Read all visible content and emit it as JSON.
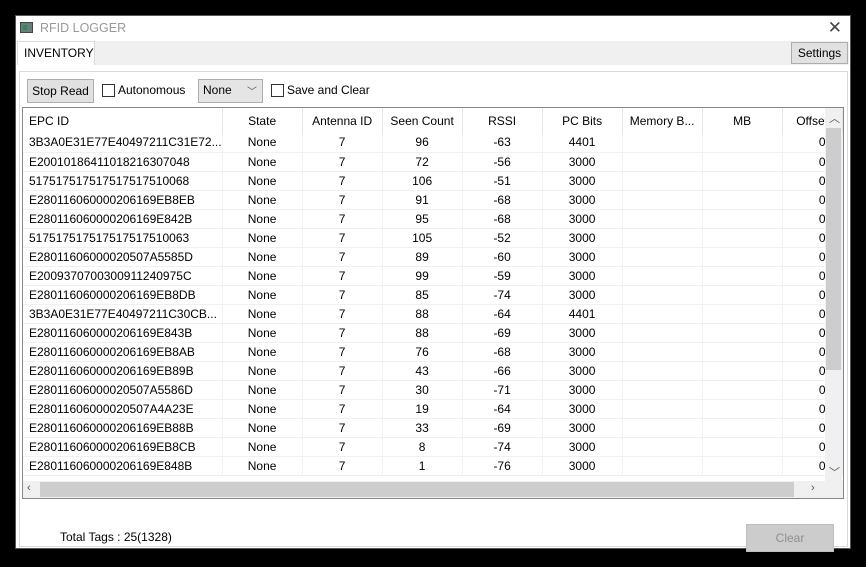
{
  "window": {
    "title": "RFID LOGGER"
  },
  "tabs": [
    {
      "label": "INVENTORY",
      "active": true
    }
  ],
  "settings_label": "Settings",
  "toolbar": {
    "stop_read_label": "Stop Read",
    "autonomous_label": "Autonomous",
    "autonomous_checked": false,
    "mode_value": "None",
    "save_clear_label": "Save and Clear",
    "save_clear_checked": false
  },
  "table": {
    "columns": [
      "EPC ID",
      "State",
      "Antenna ID",
      "Seen Count",
      "RSSI",
      "PC Bits",
      "Memory B...",
      "MB",
      "Offset"
    ],
    "rows": [
      [
        "3B3A0E31E77E40497211C31E72...",
        "None",
        "7",
        "96",
        "-63",
        "4401",
        "",
        "",
        "0"
      ],
      [
        "E20010186411018216307048",
        "None",
        "7",
        "72",
        "-56",
        "3000",
        "",
        "",
        "0"
      ],
      [
        "517517517517517517510068",
        "None",
        "7",
        "106",
        "-51",
        "3000",
        "",
        "",
        "0"
      ],
      [
        "E280116060000206169EB8EB",
        "None",
        "7",
        "91",
        "-68",
        "3000",
        "",
        "",
        "0"
      ],
      [
        "E280116060000206169E842B",
        "None",
        "7",
        "95",
        "-68",
        "3000",
        "",
        "",
        "0"
      ],
      [
        "517517517517517517510063",
        "None",
        "7",
        "105",
        "-52",
        "3000",
        "",
        "",
        "0"
      ],
      [
        "E28011606000020507A5585D",
        "None",
        "7",
        "89",
        "-60",
        "3000",
        "",
        "",
        "0"
      ],
      [
        "E2009370700300911240975C",
        "None",
        "7",
        "99",
        "-59",
        "3000",
        "",
        "",
        "0"
      ],
      [
        "E280116060000206169EB8DB",
        "None",
        "7",
        "85",
        "-74",
        "3000",
        "",
        "",
        "0"
      ],
      [
        "3B3A0E31E77E40497211C30CB...",
        "None",
        "7",
        "88",
        "-64",
        "4401",
        "",
        "",
        "0"
      ],
      [
        "E280116060000206169E843B",
        "None",
        "7",
        "88",
        "-69",
        "3000",
        "",
        "",
        "0"
      ],
      [
        "E280116060000206169EB8AB",
        "None",
        "7",
        "76",
        "-68",
        "3000",
        "",
        "",
        "0"
      ],
      [
        "E280116060000206169EB89B",
        "None",
        "7",
        "43",
        "-66",
        "3000",
        "",
        "",
        "0"
      ],
      [
        "E28011606000020507A5586D",
        "None",
        "7",
        "30",
        "-71",
        "3000",
        "",
        "",
        "0"
      ],
      [
        "E28011606000020507A4A23E",
        "None",
        "7",
        "19",
        "-64",
        "3000",
        "",
        "",
        "0"
      ],
      [
        "E280116060000206169EB88B",
        "None",
        "7",
        "33",
        "-69",
        "3000",
        "",
        "",
        "0"
      ],
      [
        "E280116060000206169EB8CB",
        "None",
        "7",
        "8",
        "-74",
        "3000",
        "",
        "",
        "0"
      ],
      [
        "E280116060000206169E848B",
        "None",
        "7",
        "1",
        "-76",
        "3000",
        "",
        "",
        "0"
      ]
    ]
  },
  "footer": {
    "total_label": "Total Tags :",
    "total_value": "25(1328)",
    "clear_label": "Clear"
  },
  "colors": {
    "button_bg": "#e1e1e1",
    "scrollbar_thumb": "#cdcdcd",
    "disabled_text": "#8f8f8f"
  }
}
